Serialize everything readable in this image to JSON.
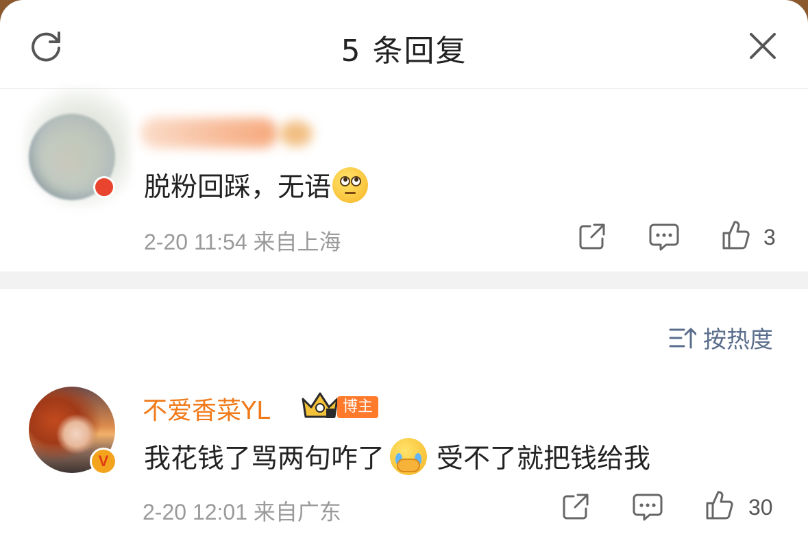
{
  "header": {
    "title": "5 条回复"
  },
  "comments": [
    {
      "text": "脱粉回踩，无语",
      "emoji": "rolling-eyes",
      "time": "2-20 11:54",
      "location": "来自上海",
      "likes": "3"
    },
    {
      "name": "不爱香菜YL",
      "badge": "博主",
      "text_before": "我花钱了骂两句咋了",
      "emoji": "crying-face-covering-mouth",
      "text_after": "受不了就把钱给我",
      "time": "2-20 12:01",
      "location": "来自广东",
      "likes": "30"
    }
  ],
  "sort": {
    "label": "按热度"
  },
  "colors": {
    "name_orange": "#f07a1a",
    "sort_blue": "#5a6e8c",
    "meta_gray": "#9a9a9a",
    "badge_orange": "#ff7a2a"
  },
  "icons": [
    "refresh-icon",
    "close-icon",
    "share-icon",
    "comment-icon",
    "like-icon",
    "sort-icon",
    "crown-icon",
    "verified-v-icon"
  ]
}
